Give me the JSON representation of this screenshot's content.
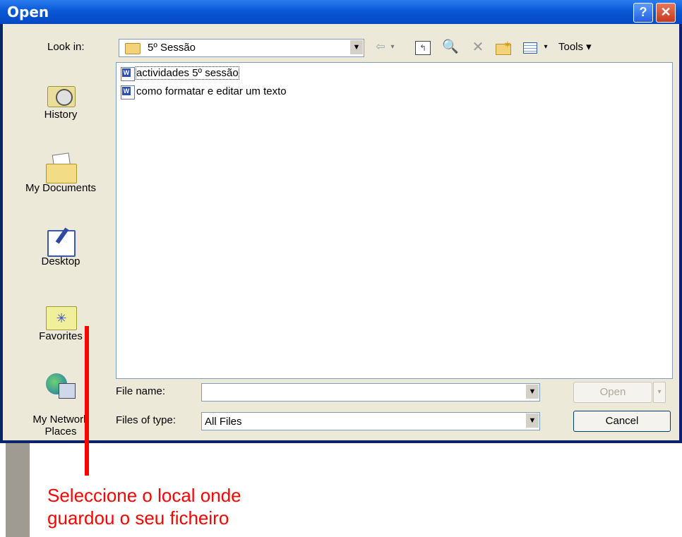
{
  "window": {
    "title": "Open",
    "help_glyph": "?",
    "close_glyph": "✕"
  },
  "toolbar": {
    "look_in_label": "Look in:",
    "look_in_value": "5º Sessão",
    "dropdown_glyph": "▼",
    "back_glyph": "⇦",
    "small_dd_glyph": "▾",
    "up_glyph": "↰",
    "search_glyph": "🔍",
    "delete_glyph": "✕",
    "tools_label": "Tools ▾"
  },
  "places": [
    {
      "label": "History",
      "icon": "history-icon"
    },
    {
      "label": "My Documents",
      "icon": "my-documents-icon"
    },
    {
      "label": "Desktop",
      "icon": "desktop-icon"
    },
    {
      "label": "Favorites",
      "icon": "favorites-icon"
    },
    {
      "label": "My Network\nPlaces",
      "icon": "network-places-icon"
    }
  ],
  "files": [
    {
      "name": "actividades 5º sessão",
      "icon": "word-doc-icon",
      "focused": true
    },
    {
      "name": "como formatar e editar um texto",
      "icon": "word-doc-icon",
      "focused": false
    }
  ],
  "word_icon_letter": "W",
  "file_name": {
    "label": "File name:",
    "value": ""
  },
  "file_type": {
    "label": "Files of type:",
    "value": "All Files"
  },
  "buttons": {
    "open": "Open",
    "cancel": "Cancel",
    "open_dd_glyph": "▾"
  },
  "annotation": {
    "line1": "Seleccione o local onde",
    "line2": "guardou o seu ficheiro",
    "color": "#ff0000"
  }
}
